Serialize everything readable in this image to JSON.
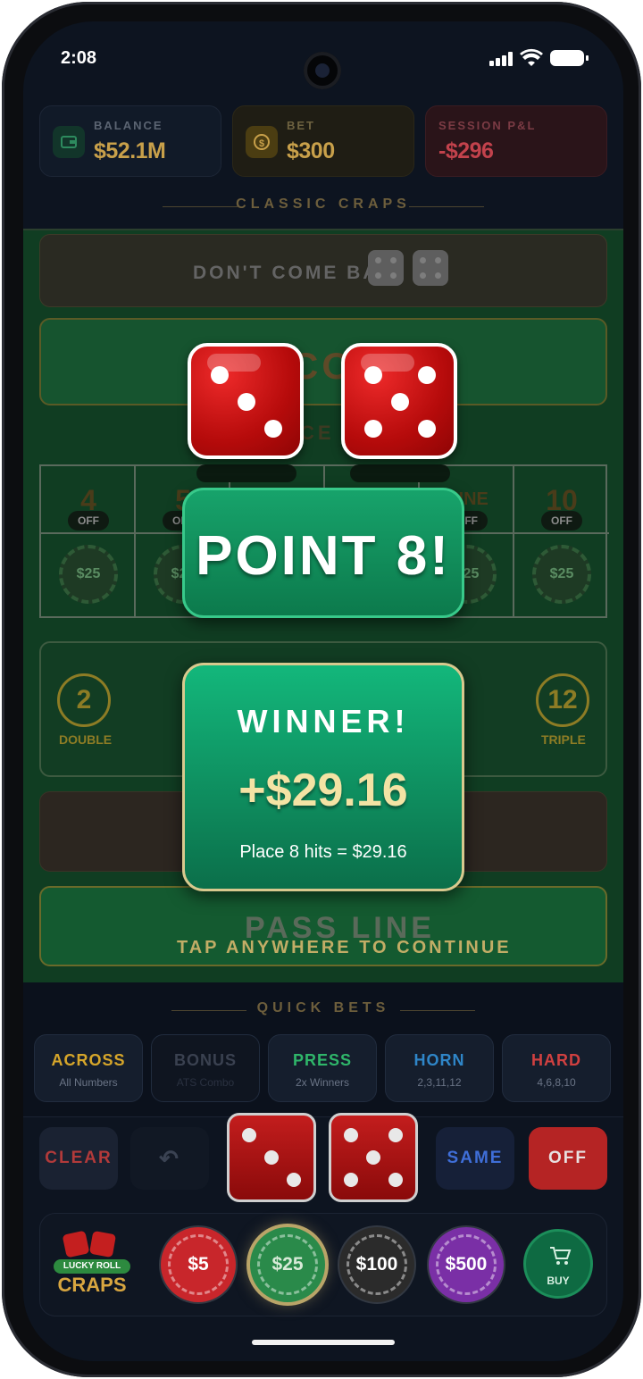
{
  "status": {
    "time": "2:08"
  },
  "stats": {
    "balance": {
      "label": "BALANCE",
      "value": "$52.1M"
    },
    "bet": {
      "label": "BET",
      "value": "$300"
    },
    "pnl": {
      "label": "SESSION P&L",
      "value": "-$296"
    }
  },
  "game_title": "CLASSIC CRAPS",
  "table": {
    "dont_come": "DON'T COME BAR",
    "come": "COME",
    "place_partial": "CE",
    "place_numbers": [
      {
        "num": "4",
        "state": "OFF",
        "chip": "$25"
      },
      {
        "num": "5",
        "state": "OFF",
        "chip": "$25"
      },
      {
        "num": "",
        "state": "",
        "chip": ""
      },
      {
        "num": "",
        "state": "",
        "chip": ""
      },
      {
        "num": "NINE",
        "state": "OFF",
        "chip": "$25"
      },
      {
        "num": "10",
        "state": "OFF",
        "chip": "$25"
      }
    ],
    "field_left_num": "2",
    "field_left_label": "DOUBLE",
    "field_right_num": "12",
    "field_right_label": "TRIPLE",
    "pass_line": "PASS LINE",
    "tap_continue": "TAP ANYWHERE TO CONTINUE"
  },
  "roll": {
    "die1": 3,
    "die2": 5
  },
  "point_banner": "POINT 8!",
  "winner": {
    "title": "WINNER!",
    "amount": "+$29.16",
    "detail": "Place 8 hits = $29.16"
  },
  "quick_bets": {
    "title": "QUICK BETS",
    "items": [
      {
        "label": "ACROSS",
        "sub": "All Numbers",
        "color": "#d6a62a"
      },
      {
        "label": "BONUS",
        "sub": "ATS Combo",
        "color": "#3a4150"
      },
      {
        "label": "PRESS",
        "sub": "2x Winners",
        "color": "#2fb66a"
      },
      {
        "label": "HORN",
        "sub": "2,3,11,12",
        "color": "#2f86c8"
      },
      {
        "label": "HARD",
        "sub": "4,6,8,10",
        "color": "#d04040"
      }
    ]
  },
  "controls": {
    "clear": "CLEAR",
    "undo": "↶",
    "same": "SAME",
    "off": "OFF"
  },
  "chips": [
    {
      "label": "$5",
      "color": "#c8262b"
    },
    {
      "label": "$25",
      "color": "#2a8a4a"
    },
    {
      "label": "$100",
      "color": "#2b2b2b"
    },
    {
      "label": "$500",
      "color": "#7a2fa6"
    }
  ],
  "logo": {
    "line1": "LUCKY ROLL",
    "line2": "CRAPS"
  },
  "buy": "BUY"
}
